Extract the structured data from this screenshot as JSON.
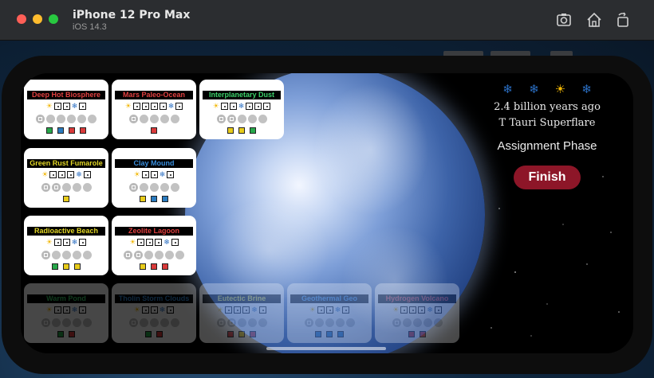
{
  "window": {
    "title": "iPhone 12 Pro Max",
    "subtitle": "iOS 14.3"
  },
  "toolbar_icons": [
    "screenshot-icon",
    "home-icon",
    "rotate-icon"
  ],
  "header": {
    "era_icons": [
      {
        "icon": "snowflake-icon",
        "glyph": "❄",
        "color": "#2a6ec2"
      },
      {
        "icon": "snowflake-icon",
        "glyph": "❄",
        "color": "#2a6ec2"
      },
      {
        "icon": "sun-icon",
        "glyph": "☀",
        "color": "#f2b705"
      },
      {
        "icon": "snowflake-icon",
        "glyph": "❄",
        "color": "#2a6ec2"
      }
    ],
    "time": "2.4 billion years ago",
    "event": "T Tauri Superflare",
    "phase": "Assignment Phase",
    "finish_label": "Finish"
  },
  "colors": {
    "finish": "#8d1628",
    "green": "#27a84a",
    "blue": "#2a7bbf",
    "red": "#d93a3a",
    "yellow": "#e8cc1a"
  },
  "cards": [
    {
      "name": "Deep Hot Biosphere",
      "title_color": "#e24141",
      "dimmed": false,
      "dice_pattern": [
        "sun",
        "die",
        "die",
        "snow",
        "die"
      ],
      "circles": 6,
      "marked": 1,
      "squares": [
        "#27a84a",
        "#2a7bbf",
        "#d93a3a",
        "#d93a3a"
      ]
    },
    {
      "name": "Mars Paleo-Ocean",
      "title_color": "#e24141",
      "dimmed": false,
      "dice_pattern": [
        "sun",
        "die",
        "die",
        "die",
        "die",
        "snow",
        "die"
      ],
      "circles": 5,
      "marked": 1,
      "squares": [
        "#d93a3a"
      ]
    },
    {
      "name": "Interplanetary Dust",
      "title_color": "#3cd06a",
      "dimmed": false,
      "dice_pattern": [
        "sun",
        "die",
        "die",
        "snow",
        "die",
        "die",
        "die"
      ],
      "circles": 5,
      "marked": 2,
      "squares": [
        "#e8cc1a",
        "#e8cc1a",
        "#27a84a"
      ]
    },
    {
      "name": "Green Rust Fumarole",
      "title_color": "#e4d826",
      "dimmed": false,
      "dice_pattern": [
        "sun",
        "die",
        "die",
        "die",
        "snow",
        "die"
      ],
      "circles": 5,
      "marked": 2,
      "squares": [
        "#e8cc1a"
      ]
    },
    {
      "name": "Clay Mound",
      "title_color": "#3a8fde",
      "dimmed": false,
      "dice_pattern": [
        "sun",
        "die",
        "die",
        "snow",
        "die"
      ],
      "circles": 5,
      "marked": 1,
      "squares": [
        "#e8cc1a",
        "#2a7bbf",
        "#2a7bbf"
      ]
    },
    {
      "name": "Radioactive Beach",
      "title_color": "#e4d826",
      "dimmed": false,
      "dice_pattern": [
        "sun",
        "die",
        "die",
        "snow",
        "die"
      ],
      "circles": 5,
      "marked": 1,
      "squares": [
        "#27a84a",
        "#e8cc1a",
        "#e8cc1a"
      ]
    },
    {
      "name": "Zeolite Lagoon",
      "title_color": "#e24141",
      "dimmed": false,
      "dice_pattern": [
        "sun",
        "die",
        "die",
        "die",
        "snow",
        "die"
      ],
      "circles": 6,
      "marked": 2,
      "squares": [
        "#e8cc1a",
        "#d93a3a",
        "#d93a3a"
      ]
    },
    {
      "name": "Warm Pond",
      "title_color": "#3cd06a",
      "dimmed": true,
      "dice_pattern": [
        "sun",
        "die",
        "die",
        "snow",
        "die"
      ],
      "circles": 5,
      "marked": 1,
      "squares": [
        "#27a84a",
        "#d93a3a"
      ]
    },
    {
      "name": "Tholin Storm Clouds",
      "title_color": "#3a8fde",
      "dimmed": true,
      "dice_pattern": [
        "sun",
        "die",
        "die",
        "snow",
        "die"
      ],
      "circles": 5,
      "marked": 1,
      "squares": [
        "#27a84a",
        "#d93a3a"
      ]
    },
    {
      "name": "Eutectic Brine",
      "title_color": "#e4d826",
      "dimmed": true,
      "dice_pattern": [
        "sun",
        "die",
        "die",
        "die",
        "snow",
        "die"
      ],
      "circles": 5,
      "marked": 2,
      "squares": [
        "#d93a3a",
        "#e8cc1a",
        "#d93a3a"
      ]
    },
    {
      "name": "Geothermal Geo",
      "title_color": "#3a8fde",
      "dimmed": true,
      "dice_pattern": [
        "sun",
        "die",
        "die",
        "snow",
        "die"
      ],
      "circles": 5,
      "marked": 1,
      "squares": [
        "#2a7bbf",
        "#2a7bbf",
        "#2a7bbf"
      ]
    },
    {
      "name": "Hydrogen Volcano",
      "title_color": "#e24141",
      "dimmed": true,
      "dice_pattern": [
        "sun",
        "die",
        "die",
        "die",
        "snow",
        "die"
      ],
      "circles": 5,
      "marked": 1,
      "squares": [
        "#d93a3a",
        "#d93a3a"
      ]
    }
  ]
}
